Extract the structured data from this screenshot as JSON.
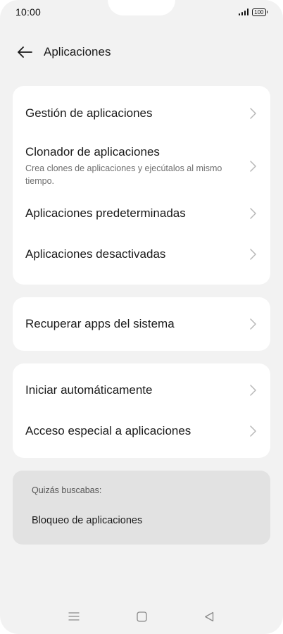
{
  "status_bar": {
    "time": "10:00",
    "battery": "100"
  },
  "header": {
    "title": "Aplicaciones",
    "back_icon": "arrow-left-icon"
  },
  "group1": {
    "items": [
      {
        "label": "Gestión de aplicaciones"
      },
      {
        "label": "Clonador de aplicaciones",
        "subtitle": "Crea clones de aplicaciones y ejecútalos al mismo tiempo."
      },
      {
        "label": "Aplicaciones predeterminadas"
      },
      {
        "label": "Aplicaciones desactivadas"
      }
    ]
  },
  "group2": {
    "items": [
      {
        "label": "Recuperar apps del sistema"
      }
    ]
  },
  "group3": {
    "items": [
      {
        "label": "Iniciar automáticamente"
      },
      {
        "label": "Acceso especial a aplicaciones"
      }
    ]
  },
  "suggestions": {
    "label": "Quizás buscabas:",
    "link": "Bloqueo de aplicaciones"
  },
  "nav": {
    "menu_icon": "menu-icon",
    "home_icon": "square-home-icon",
    "back_icon": "triangle-back-icon"
  },
  "colors": {
    "background": "#f2f2f2",
    "card": "#ffffff",
    "suggest_bg": "#e2e2e2"
  }
}
